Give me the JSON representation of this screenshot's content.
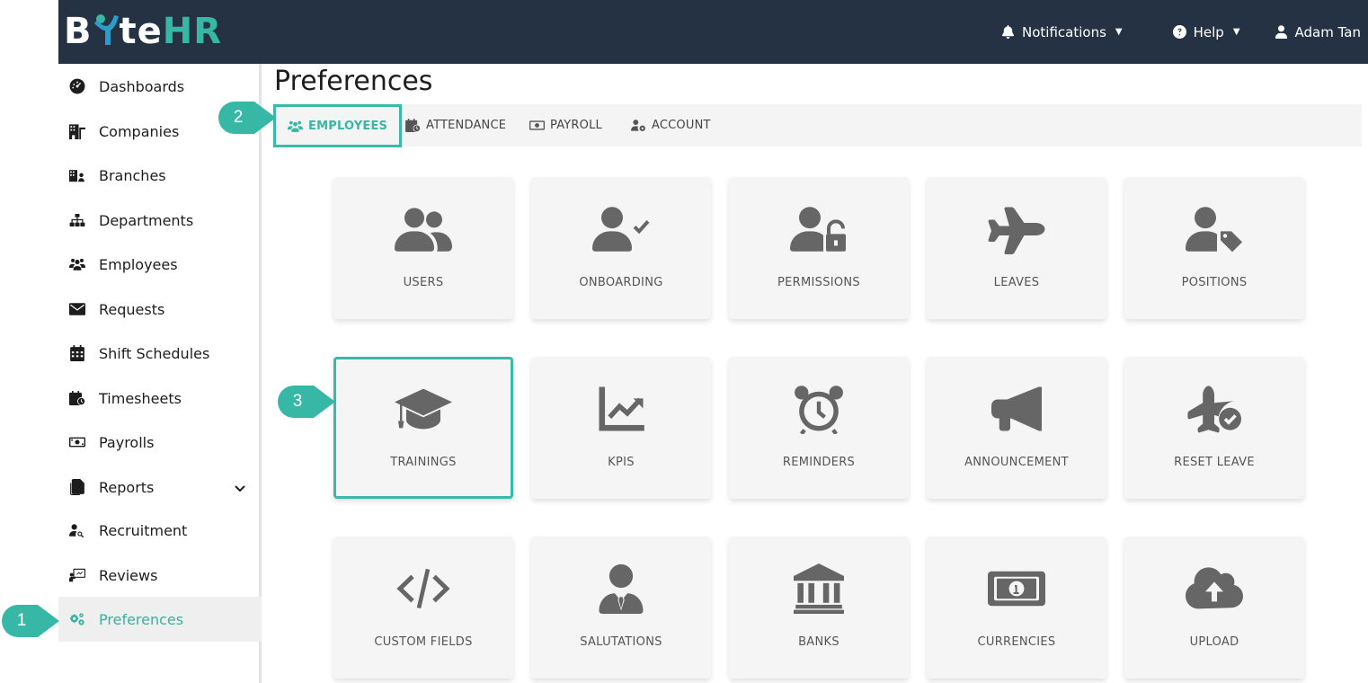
{
  "app": {
    "logo_prefix": "B",
    "logo_middle": "te",
    "logo_suffix": "HR"
  },
  "topbar": {
    "notifications_label": "Notifications",
    "help_label": "Help",
    "user_label": "Adam Tan"
  },
  "sidebar": {
    "items": [
      {
        "label": "Dashboards",
        "icon": "gauge-icon"
      },
      {
        "label": "Companies",
        "icon": "building-icon"
      },
      {
        "label": "Branches",
        "icon": "building-user-icon"
      },
      {
        "label": "Departments",
        "icon": "sitemap-icon"
      },
      {
        "label": "Employees",
        "icon": "users-icon"
      },
      {
        "label": "Requests",
        "icon": "envelope-icon"
      },
      {
        "label": "Shift Schedules",
        "icon": "calendar-icon"
      },
      {
        "label": "Timesheets",
        "icon": "calendar-clock-icon"
      },
      {
        "label": "Payrolls",
        "icon": "money-bill-icon"
      },
      {
        "label": "Reports",
        "icon": "copy-icon"
      },
      {
        "label": "Recruitment",
        "icon": "user-search-icon"
      },
      {
        "label": "Reviews",
        "icon": "chalkboard-user-icon"
      },
      {
        "label": "Preferences",
        "icon": "gears-icon",
        "active": true
      }
    ]
  },
  "main": {
    "title": "Preferences",
    "tabs": [
      {
        "label": "EMPLOYEES",
        "active": true
      },
      {
        "label": "ATTENDANCE"
      },
      {
        "label": "PAYROLL"
      },
      {
        "label": "ACCOUNT"
      }
    ],
    "tiles": [
      {
        "label": "USERS",
        "icon": "users-icon"
      },
      {
        "label": "ONBOARDING",
        "icon": "user-check-icon"
      },
      {
        "label": "PERMISSIONS",
        "icon": "user-lock-icon"
      },
      {
        "label": "LEAVES",
        "icon": "plane-icon"
      },
      {
        "label": "POSITIONS",
        "icon": "user-tag-icon"
      },
      {
        "label": "TRAININGS",
        "icon": "graduation-cap-icon"
      },
      {
        "label": "KPIS",
        "icon": "chart-line-icon"
      },
      {
        "label": "REMINDERS",
        "icon": "alarm-clock-icon"
      },
      {
        "label": "ANNOUNCEMENT",
        "icon": "bullhorn-icon"
      },
      {
        "label": "RESET LEAVE",
        "icon": "plane-circle-check-icon"
      },
      {
        "label": "CUSTOM FIELDS",
        "icon": "code-icon"
      },
      {
        "label": "SALUTATIONS",
        "icon": "user-tie-icon"
      },
      {
        "label": "BANKS",
        "icon": "bank-icon"
      },
      {
        "label": "CURRENCIES",
        "icon": "money-bill-1-icon"
      },
      {
        "label": "UPLOAD",
        "icon": "cloud-upload-icon"
      }
    ]
  },
  "callouts": [
    "1",
    "2",
    "3"
  ],
  "colors": {
    "topbar": "#253244",
    "accent": "#37b7a6",
    "tile_bg": "#f5f5f5",
    "icon_gray": "#666666"
  }
}
